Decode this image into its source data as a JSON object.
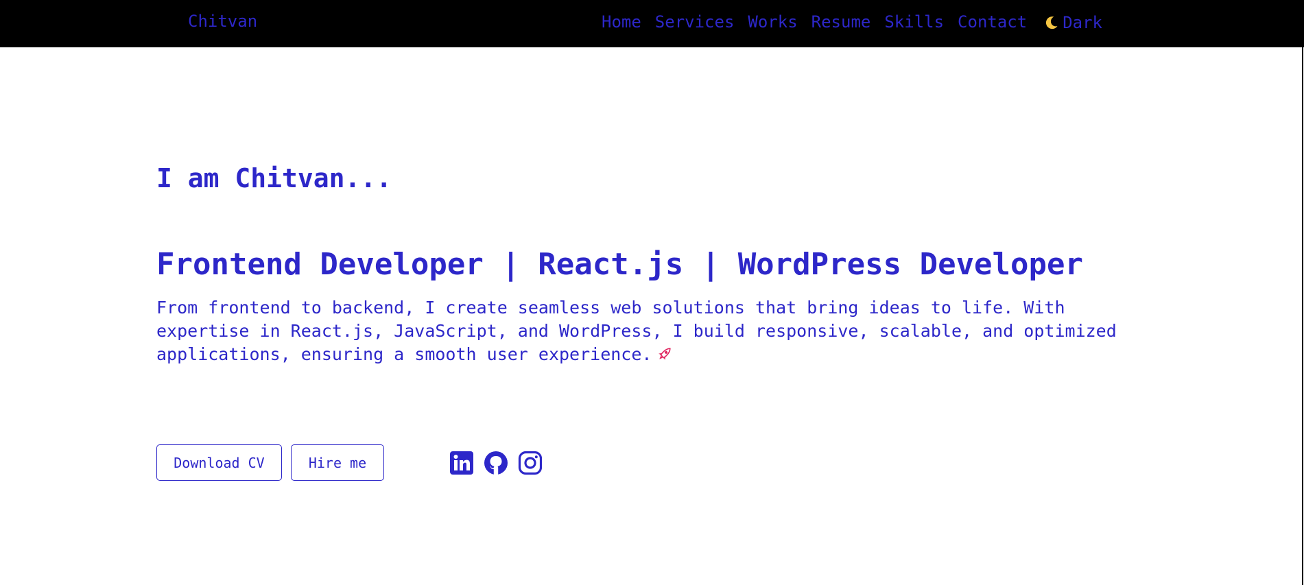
{
  "nav": {
    "brand": "Chitvan",
    "links": [
      "Home",
      "Services",
      "Works",
      "Resume",
      "Skills",
      "Contact"
    ],
    "theme_toggle_label": "Dark",
    "theme_toggle_icon": "moon-icon"
  },
  "hero": {
    "intro": "I am Chitvan...",
    "headline": "Frontend Developer | React.js | WordPress Developer",
    "description": "From frontend to backend, I create seamless web solutions that bring ideas to life. With expertise in React.js, JavaScript, and WordPress, I build responsive, scalable, and optimized applications, ensuring a smooth user experience.",
    "description_icon": "rocket-icon"
  },
  "actions": {
    "download_cv": "Download CV",
    "hire_me": "Hire me"
  },
  "socials": [
    "linkedin-icon",
    "github-icon",
    "instagram-icon"
  ],
  "colors": {
    "accent": "#2d27c9",
    "nav_background": "#000000",
    "page_background": "#ffffff",
    "moon": "#f5c542",
    "rocket": "#e0245e"
  }
}
